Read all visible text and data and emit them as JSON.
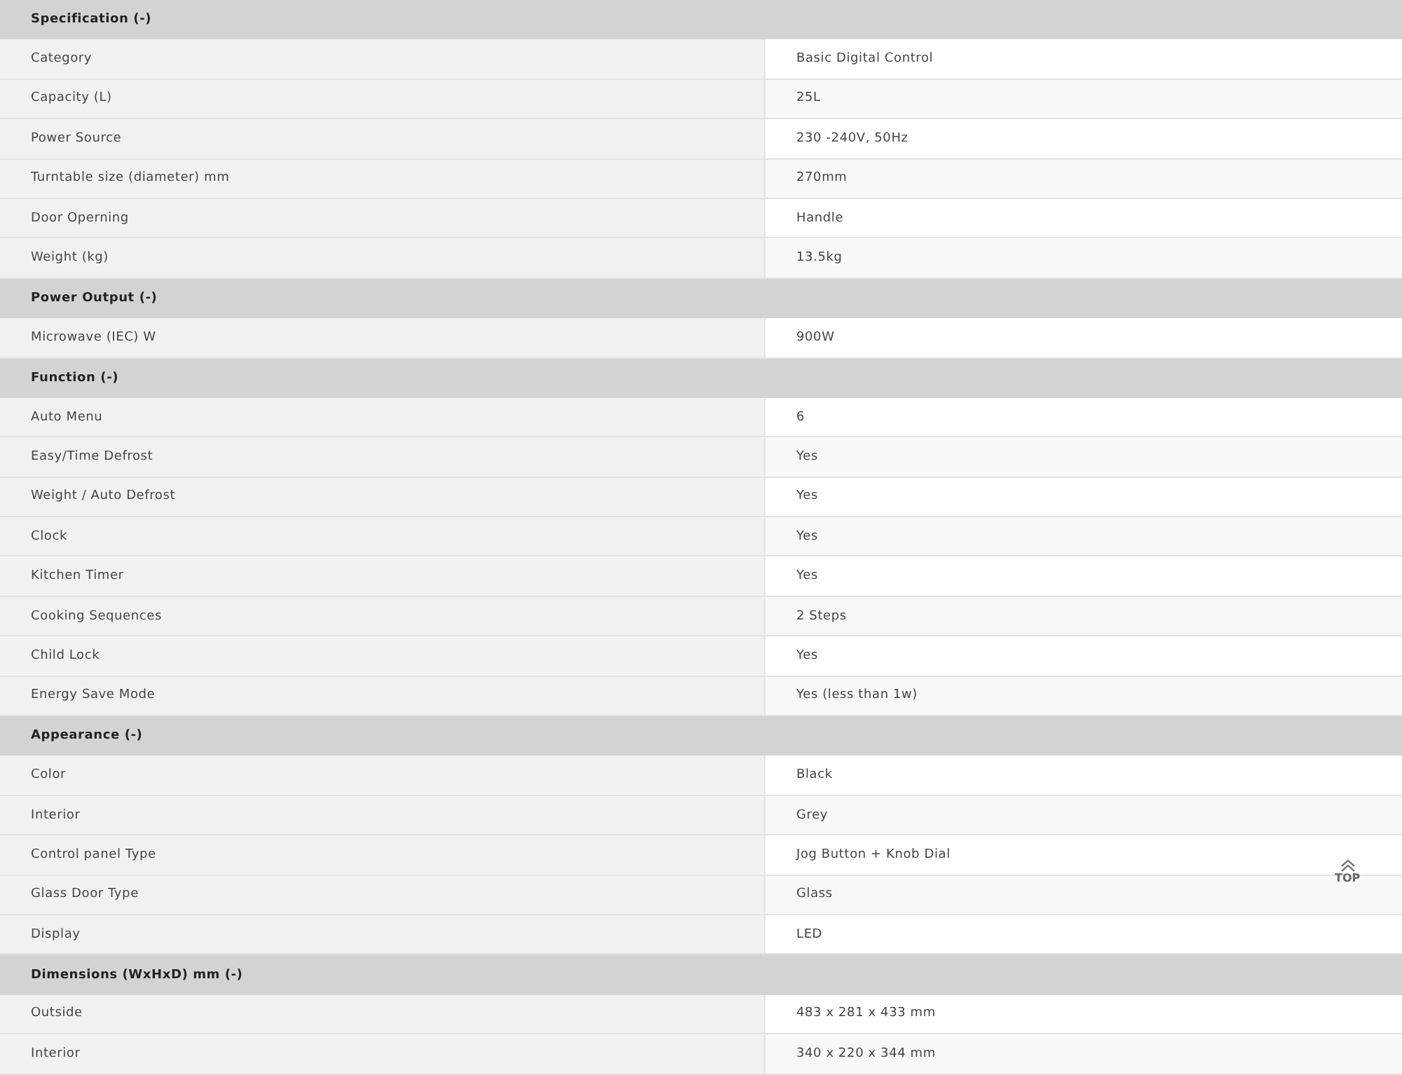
{
  "sections": [
    {
      "title": "Specification (-)",
      "rows": [
        {
          "label": "Category",
          "value": "Basic Digital Control"
        },
        {
          "label": "Capacity (L)",
          "value": "25L"
        },
        {
          "label": "Power Source",
          "value": "230 -240V, 50Hz"
        },
        {
          "label": "Turntable size (diameter) mm",
          "value": "270mm"
        },
        {
          "label": "Door Operning",
          "value": "Handle"
        },
        {
          "label": "Weight (kg)",
          "value": "13.5kg"
        }
      ]
    },
    {
      "title": "Power Output (-)",
      "rows": [
        {
          "label": "Microwave (IEC) W",
          "value": "900W"
        }
      ]
    },
    {
      "title": "Function (-)",
      "rows": [
        {
          "label": "Auto Menu",
          "value": "6"
        },
        {
          "label": "Easy/Time Defrost",
          "value": "Yes"
        },
        {
          "label": "Weight / Auto Defrost",
          "value": "Yes"
        },
        {
          "label": "Clock",
          "value": "Yes"
        },
        {
          "label": "Kitchen Timer",
          "value": "Yes"
        },
        {
          "label": "Cooking Sequences",
          "value": "2 Steps"
        },
        {
          "label": "Child Lock",
          "value": "Yes"
        },
        {
          "label": "Energy Save Mode",
          "value": "Yes (less than 1w)"
        }
      ]
    },
    {
      "title": "Appearance (-)",
      "rows": [
        {
          "label": "Color",
          "value": "Black"
        },
        {
          "label": "Interior",
          "value": "Grey"
        },
        {
          "label": "Control panel Type",
          "value": "Jog Button + Knob Dial"
        },
        {
          "label": "Glass Door Type",
          "value": "Glass"
        },
        {
          "label": "Display",
          "value": "LED"
        }
      ]
    },
    {
      "title": "Dimensions (WxHxD) mm (-)",
      "rows": [
        {
          "label": "Outside",
          "value": "483 x 281 x 433 mm"
        },
        {
          "label": "Interior",
          "value": "340 x 220 x 344 mm"
        }
      ]
    }
  ],
  "top_button": {
    "label": "TOP"
  }
}
